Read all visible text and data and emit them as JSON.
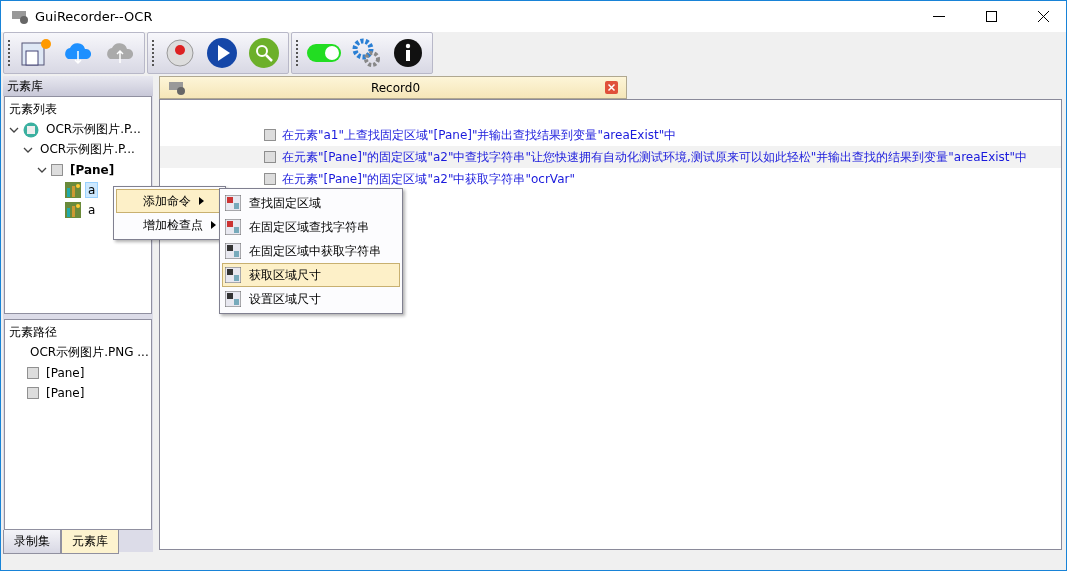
{
  "window": {
    "title": "GuiRecorder--OCR"
  },
  "toolbar": [
    {
      "kind": "new"
    },
    {
      "kind": "download"
    },
    {
      "kind": "upload",
      "disabled": true
    },
    {
      "kind": "sep"
    },
    {
      "kind": "record"
    },
    {
      "kind": "play"
    },
    {
      "kind": "search"
    },
    {
      "kind": "sep"
    },
    {
      "kind": "toggle",
      "on": true
    },
    {
      "kind": "settings"
    },
    {
      "kind": "info"
    }
  ],
  "left_panel": {
    "title": "元素库",
    "element_list": {
      "title": "元素列表",
      "tree": [
        {
          "label": "OCR示例图片.P...",
          "kind": "app",
          "expanded": true,
          "selected": false,
          "children": [
            {
              "label": "OCR示例图片.P...",
              "expanded": true,
              "selected": false,
              "children": [
                {
                  "label": "[Pane]",
                  "kind": "pane",
                  "bold": true,
                  "expanded": true,
                  "selected": false,
                  "children": [
                    {
                      "label": "a",
                      "kind": "image",
                      "selected": true
                    },
                    {
                      "label": "a",
                      "kind": "image",
                      "selected": false
                    }
                  ]
                }
              ]
            }
          ]
        }
      ]
    },
    "element_path": {
      "title": "元素路径",
      "items": [
        {
          "label": "OCR示例图片.PNG ..."
        },
        {
          "label": "[Pane]",
          "kind": "pane"
        },
        {
          "label": "[Pane]",
          "kind": "pane"
        }
      ]
    },
    "tabs": [
      {
        "label": "录制集",
        "selected": false
      },
      {
        "label": "元素库",
        "selected": true
      }
    ]
  },
  "document": {
    "tab": {
      "title": "Record0"
    },
    "steps": [
      {
        "text": "在元素\"a1\"上查找固定区域\"[Pane]\"并输出查找结果到变量\"areaExist\"中",
        "selected": false
      },
      {
        "text": "在元素\"[Pane]\"的固定区域\"a2\"中查找字符串\"让您快速拥有自动化测试环境,测试原来可以如此轻松\"并输出查找的结果到变量\"areaExist\"中",
        "selected": true
      },
      {
        "text": "在元素\"[Pane]\"的固定区域\"a2\"中获取字符串\"ocrVar\"",
        "selected": false
      }
    ]
  },
  "context_menu": {
    "items": [
      {
        "label": "添加命令",
        "selected": true
      },
      {
        "label": "增加检查点",
        "selected": false
      }
    ],
    "submenu": [
      {
        "label": "查找固定区域",
        "kind": "find",
        "selected": false
      },
      {
        "label": "在固定区域查找字符串",
        "kind": "findtext",
        "selected": false
      },
      {
        "label": "在固定区域中获取字符串",
        "kind": "gettext",
        "selected": false
      },
      {
        "label": "获取区域尺寸",
        "kind": "getsize",
        "selected": true
      },
      {
        "label": "设置区域尺寸",
        "kind": "setsize",
        "selected": false
      }
    ]
  }
}
